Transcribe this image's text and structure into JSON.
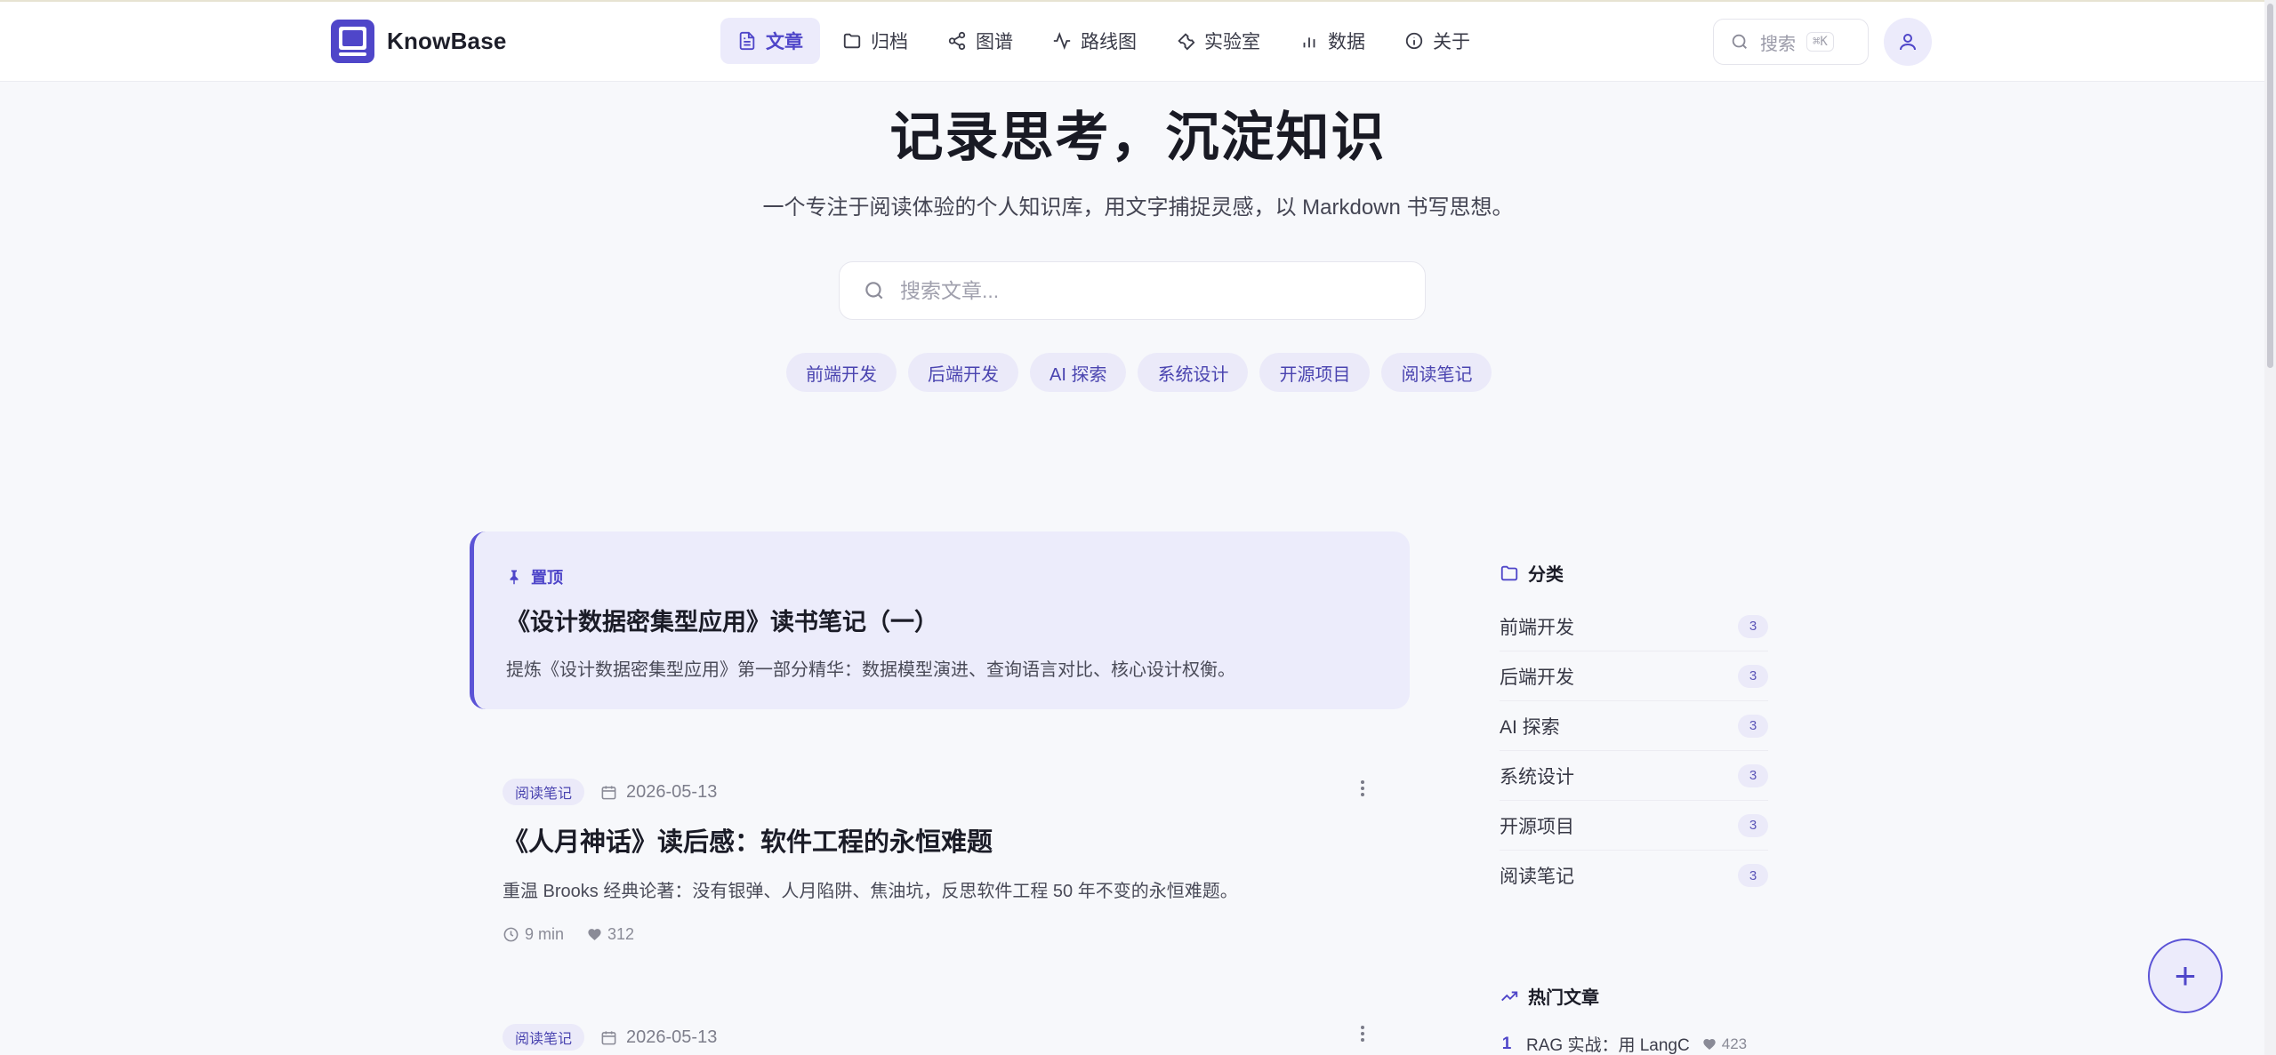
{
  "brand": {
    "name": "KnowBase",
    "accent": "#4f46c9"
  },
  "nav": [
    {
      "label": "文章",
      "icon": "file-text-icon",
      "active": true
    },
    {
      "label": "归档",
      "icon": "folder-icon",
      "active": false
    },
    {
      "label": "图谱",
      "icon": "share-graph-icon",
      "active": false
    },
    {
      "label": "路线图",
      "icon": "activity-icon",
      "active": false
    },
    {
      "label": "实验室",
      "icon": "wrench-icon",
      "active": false
    },
    {
      "label": "数据",
      "icon": "bar-chart-icon",
      "active": false
    },
    {
      "label": "关于",
      "icon": "info-icon",
      "active": false
    }
  ],
  "header_search": {
    "placeholder": "搜索",
    "shortcut": "⌘K"
  },
  "hero": {
    "title": "记录思考，沉淀知识",
    "subtitle": "一个专注于阅读体验的个人知识库，用文字捕捉灵感，以 Markdown 书写思想。",
    "search_placeholder": "搜索文章..."
  },
  "tags": [
    "前端开发",
    "后端开发",
    "AI 探索",
    "系统设计",
    "开源项目",
    "阅读笔记"
  ],
  "pinned": {
    "label": "置顶",
    "title": "《设计数据密集型应用》读书笔记（一）",
    "desc": "提炼《设计数据密集型应用》第一部分精华：数据模型演进、查询语言对比、核心设计权衡。"
  },
  "articles": [
    {
      "category": "阅读笔记",
      "date": "2026-05-13",
      "title": "《人月神话》读后感：软件工程的永恒难题",
      "desc": "重温 Brooks 经典论著：没有银弹、人月陷阱、焦油坑，反思软件工程 50 年不变的永恒难题。",
      "read_time": "9 min",
      "likes": "312"
    },
    {
      "category": "阅读笔记",
      "date": "2026-05-13"
    }
  ],
  "sidebar": {
    "categories_title": "分类",
    "categories": [
      {
        "name": "前端开发",
        "count": "3"
      },
      {
        "name": "后端开发",
        "count": "3"
      },
      {
        "name": "AI 探索",
        "count": "3"
      },
      {
        "name": "系统设计",
        "count": "3"
      },
      {
        "name": "开源项目",
        "count": "3"
      },
      {
        "name": "阅读笔记",
        "count": "3"
      }
    ],
    "hot_title": "热门文章",
    "hot": [
      {
        "rank": "1",
        "title": "RAG 实战：用 LangC",
        "likes": "423"
      }
    ]
  },
  "fab": {
    "label": "+"
  }
}
